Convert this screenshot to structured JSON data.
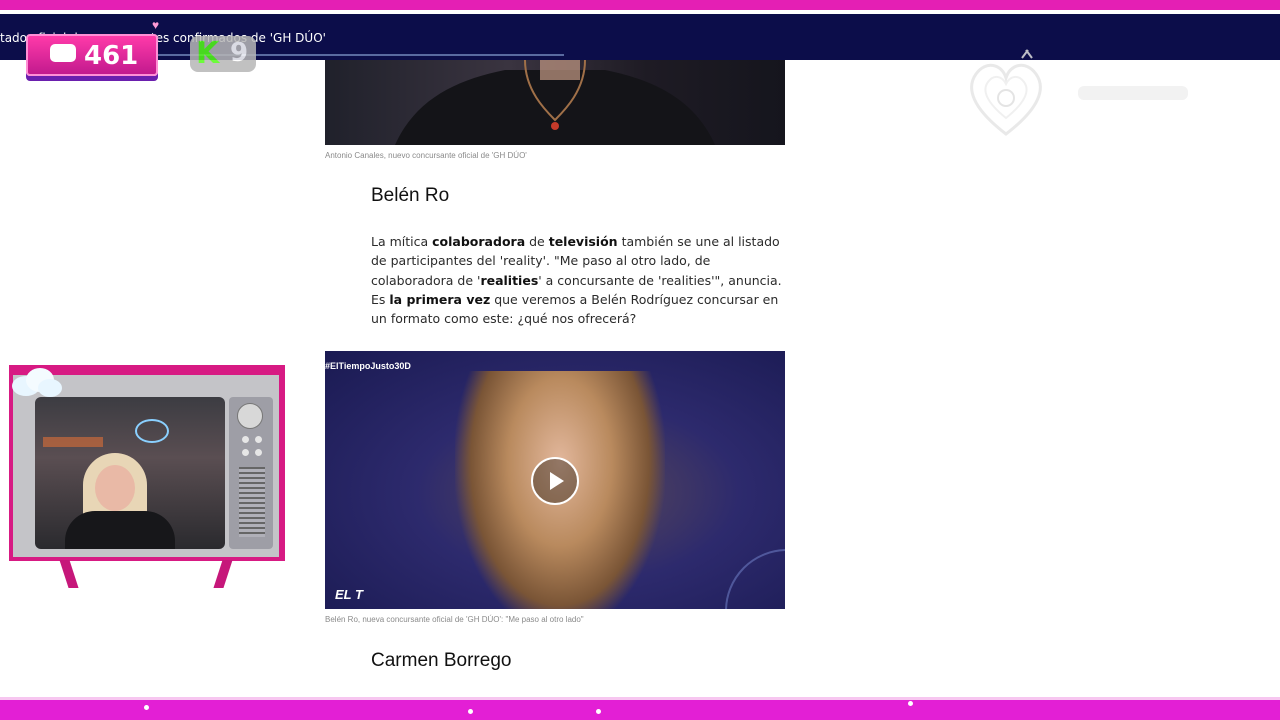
{
  "overlay": {
    "ticker_text": "tado oficial de concursantes confirmados de 'GH DÚO'",
    "chat_count": "461",
    "kick_letter": "K",
    "kick_count": "9"
  },
  "article": {
    "caption_1": "Antonio Canales, nuevo concursante oficial de 'GH DÚO'",
    "heading_1": "Belén Ro",
    "paragraph_html_parts": {
      "p1": "La mítica ",
      "b1": "colaboradora",
      "p2": " de ",
      "b2": "televisión",
      "p3": " también se une al listado de participantes del 'reality'. \"Me paso al otro lado, de colaboradora de '",
      "b3": "realities",
      "p4": "' a concursante de 'realities'\", anuncia. Es ",
      "b4": "la primera vez",
      "p5": " que veremos a Belén Rodríguez concursar en un formato como este: ¿qué nos ofrecerá?"
    },
    "video_tag": "#ElTiempoJusto30D",
    "video_logo": "EL T",
    "caption_2": "Belén Ro, nueva concursante oficial de 'GH DÚO': \"Me paso al otro lado\"",
    "heading_2": "Carmen Borrego"
  },
  "colors": {
    "accent_pink": "#e41fb4",
    "ticker_bg": "#0c0d4a",
    "kick_green": "#53fc18"
  }
}
